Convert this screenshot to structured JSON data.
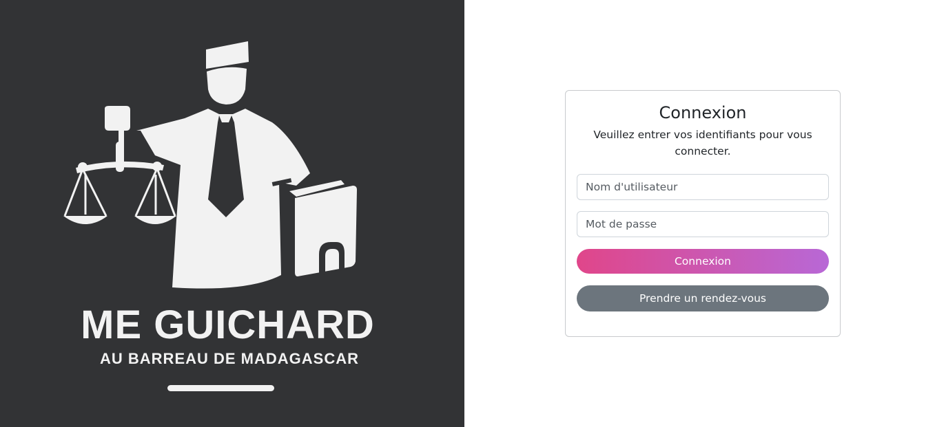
{
  "brand": {
    "name": "ME GUICHARD",
    "subtitle": "AU BARREAU DE MADAGASCAR",
    "logo_icon": "lawyer-with-scales-and-book"
  },
  "login": {
    "title": "Connexion",
    "instructions": "Veuillez entrer vos identifiants pour vous connecter.",
    "username_placeholder": "Nom d'utilisateur",
    "username_value": "",
    "password_placeholder": "Mot de passe",
    "password_value": "",
    "submit_label": "Connexion",
    "appointment_label": "Prendre un rendez-vous"
  },
  "colors": {
    "brand_panel": "#323335",
    "login_gradient_start": "#e0468a",
    "login_gradient_end": "#b868d6",
    "secondary_button": "#6c757d"
  }
}
